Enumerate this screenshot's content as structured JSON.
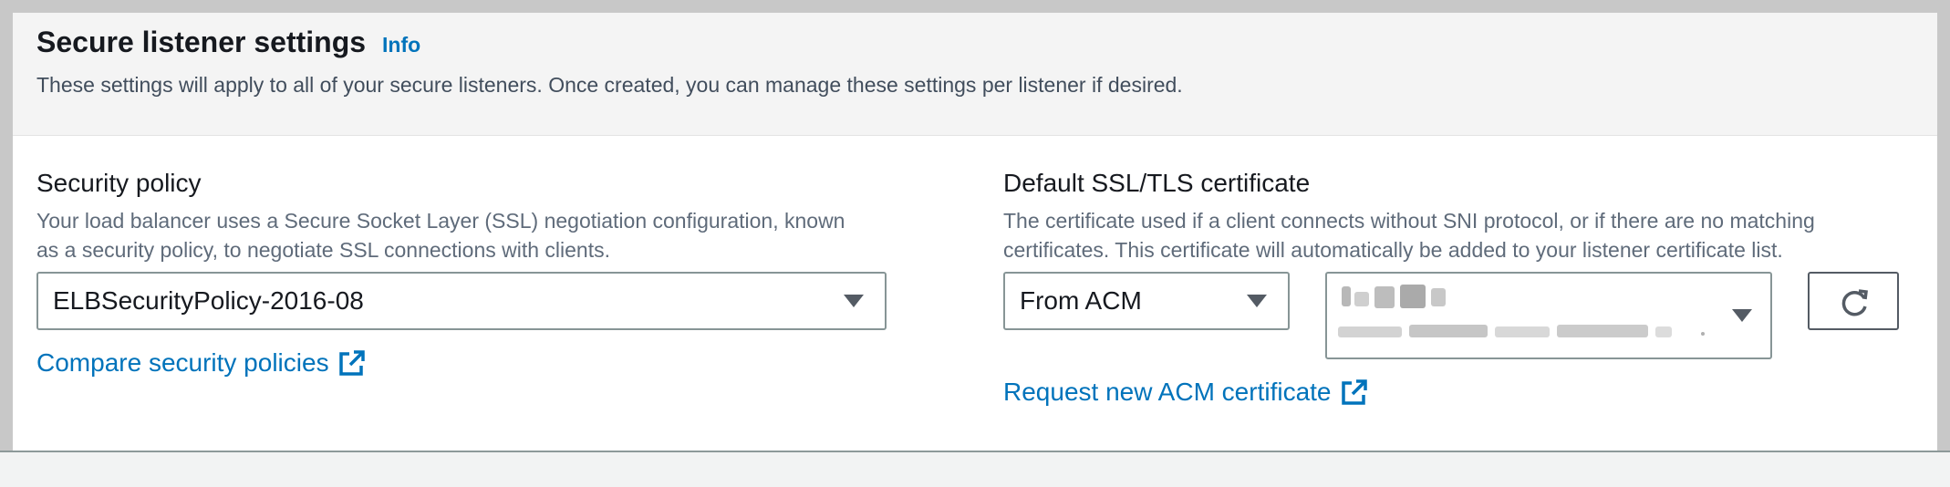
{
  "header": {
    "title": "Secure listener settings",
    "info_label": "Info",
    "description": "These settings will apply to all of your secure listeners. Once created, you can manage these settings per listener if desired."
  },
  "security_policy": {
    "label": "Security policy",
    "description_line1": "Your load balancer uses a Secure Socket Layer (SSL) negotiation configuration, known",
    "description_line2": "as a security policy, to negotiate SSL connections with clients.",
    "selected_value": "ELBSecurityPolicy-2016-08",
    "compare_link": "Compare security policies"
  },
  "certificate": {
    "label": "Default SSL/TLS certificate",
    "description_line1": "The certificate used if a client connects without SNI protocol, or if there are no matching",
    "description_line2": "certificates. This certificate will automatically be added to your listener certificate list.",
    "source_value": "From ACM",
    "request_link": "Request new ACM certificate"
  },
  "icons": {
    "caret": "caret-down-icon",
    "external": "external-link-icon",
    "refresh": "refresh-icon"
  },
  "colors": {
    "link": "#0073bb",
    "header_bg": "#f4f4f4",
    "border": "#879596"
  }
}
